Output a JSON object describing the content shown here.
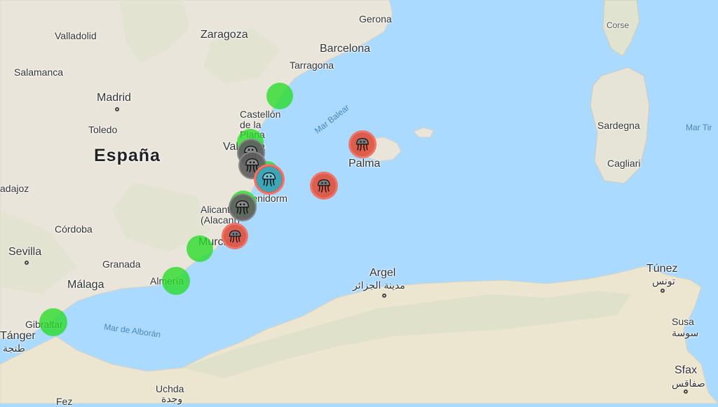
{
  "map": {
    "country_label": "España",
    "seas": [
      "Mar Balear",
      "Mar de Alborán",
      "Mar Tir"
    ],
    "cities": [
      "Valladolid",
      "Zaragoza",
      "Gerona",
      "Barcelona",
      "Tarragona",
      "Salamanca",
      "Madrid",
      "Castellón de la Plana",
      "Toledo",
      "Valencia",
      "Palma",
      "adajoz",
      "Benidorm",
      "Alicante (Alacant)",
      "Córdoba",
      "Murcia",
      "Sevilla",
      "Granada",
      "Málaga",
      "Almería",
      "Gibraltar",
      "Tánger",
      "طنجة",
      "Argel",
      "مدينة الجزائر",
      "Túnez",
      "تونس",
      "Susa",
      "سوسة",
      "Sfax",
      "صفاقس",
      "Uchda",
      "وجدة",
      "Corse",
      "Sardegna",
      "Cagliari",
      "Fez",
      "Alicante"
    ],
    "colors": {
      "sea": "#aadaff",
      "land_spain": "#e8e4d9",
      "land_africa": "#ece6d0",
      "green_marker": "#28dc28",
      "red_marker": "#e0533e",
      "grey_marker": "#6a6a6a",
      "teal_marker": "#3aa6b8"
    },
    "markers": [
      {
        "kind": "green",
        "icon": ""
      },
      {
        "kind": "green",
        "icon": ""
      },
      {
        "kind": "green",
        "icon": ""
      },
      {
        "kind": "green",
        "icon": ""
      },
      {
        "kind": "green",
        "icon": ""
      },
      {
        "kind": "green",
        "icon": ""
      },
      {
        "kind": "green",
        "icon": ""
      },
      {
        "kind": "red",
        "icon": "jellyfish-icon"
      },
      {
        "kind": "red",
        "icon": "jellyfish-icon"
      },
      {
        "kind": "red",
        "icon": "jellyfish-icon"
      },
      {
        "kind": "grey",
        "icon": "jellyfish-icon"
      },
      {
        "kind": "grey",
        "icon": "jellyfish-icon"
      },
      {
        "kind": "grey",
        "icon": "jellyfish-icon"
      },
      {
        "kind": "teal",
        "icon": "jellyfish-icon"
      },
      {
        "kind": "red",
        "icon": "jellyfish-icon"
      }
    ]
  }
}
